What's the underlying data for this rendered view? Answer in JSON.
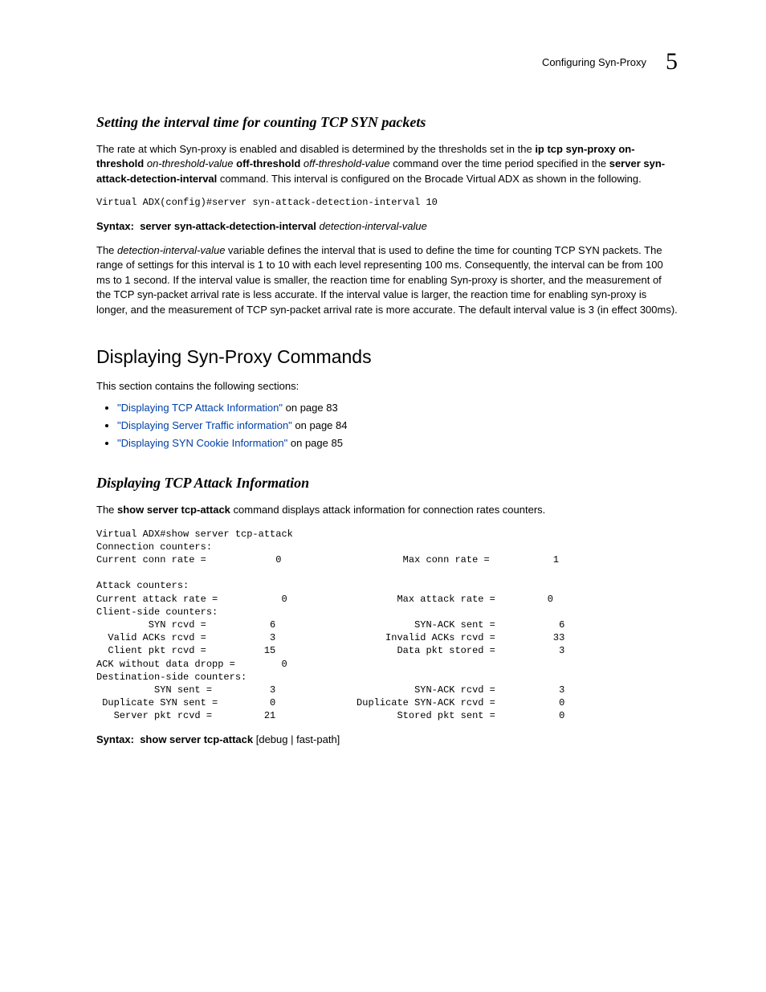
{
  "header": {
    "breadcrumb": "Configuring Syn-Proxy",
    "chapter_number": "5"
  },
  "h_interval": "Setting the interval time for counting TCP SYN packets",
  "p1": {
    "t1": "The rate at which Syn-proxy is enabled and disabled is determined by the thresholds set in the ",
    "b1": "ip tcp syn-proxy on-threshold",
    "i1": " on-threshold-value ",
    "b2": "off-threshold",
    "i2": " off-threshold-value",
    "t2": " command over the time period specified in the ",
    "b3": "server syn-attack-detection-interval",
    "t3": " command. This interval is configured on the Brocade Virtual ADX as shown in the following."
  },
  "code1": "Virtual ADX(config)#server syn-attack-detection-interval 10",
  "syntax1": {
    "label": "Syntax:",
    "cmd": "server syn-attack-detection-interval",
    "arg": " detection-interval-value"
  },
  "p2": {
    "t1": "The ",
    "i1": "detection-interval-value",
    "t2": " variable defines the interval that is used to define the time for counting TCP SYN packets. The range of settings for this interval is 1 to 10 with each level representing 100 ms. Consequently, the interval can be from 100 ms to 1 second. If the interval value is smaller, the reaction time for enabling Syn-proxy is shorter, and the measurement of the TCP syn-packet arrival rate is less accurate. If the interval value is larger, the reaction time for enabling syn-proxy is longer, and the measurement of TCP syn-packet arrival rate is more accurate. The default interval value is 3 (in effect 300ms)."
  },
  "h_display_cmds": "Displaying Syn-Proxy Commands",
  "p3": "This section contains the following sections:",
  "links": [
    {
      "text": "\"Displaying TCP Attack Information\"",
      "suffix": " on page 83"
    },
    {
      "text": "\"Displaying Server Traffic information\"",
      "suffix": " on page 84"
    },
    {
      "text": "\"Displaying SYN Cookie Information\"",
      "suffix": " on page 85"
    }
  ],
  "h_tcp_attack": "Displaying TCP Attack Information",
  "p4": {
    "t1": "The ",
    "b1": "show server tcp-attack",
    "t2": " command displays attack information for connection rates counters."
  },
  "code2": "Virtual ADX#show server tcp-attack\nConnection counters:\nCurrent conn rate =            0                     Max conn rate =           1\n\nAttack counters:\nCurrent attack rate =           0                   Max attack rate =         0\nClient-side counters:\n         SYN rcvd =           6                        SYN-ACK sent =           6\n  Valid ACKs rcvd =           3                   Invalid ACKs rcvd =          33\n  Client pkt rcvd =          15                     Data pkt stored =           3\nACK without data dropp =        0\nDestination-side counters:\n          SYN sent =          3                        SYN-ACK rcvd =           3\n Duplicate SYN sent =         0              Duplicate SYN-ACK rcvd =           0\n   Server pkt rcvd =         21                     Stored pkt sent =           0",
  "syntax2": {
    "label": "Syntax:",
    "cmd": "show server tcp-attack",
    "tail": " [debug | fast-path]"
  }
}
